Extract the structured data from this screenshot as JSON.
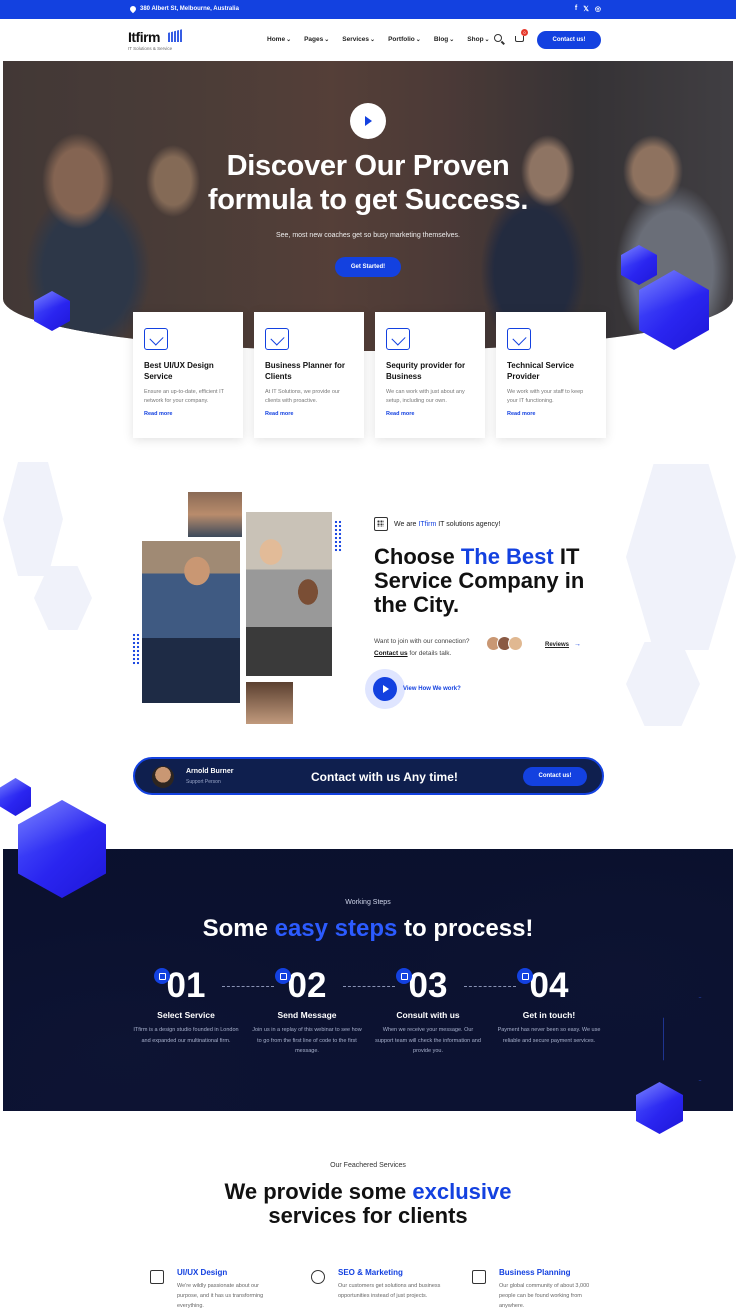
{
  "topbar": {
    "address": "380 Albert St, Melbourne, Australia",
    "social": [
      "f",
      "𝕏",
      "◎"
    ]
  },
  "header": {
    "logo_name": "Itfirm",
    "logo_tagline": "IT Solutions & Service",
    "nav": [
      "Home",
      "Pages",
      "Services",
      "Portfolio",
      "Blog",
      "Shop"
    ],
    "cart_count": "0",
    "cta": "Contact us!"
  },
  "hero": {
    "title_line1": "Discover Our Proven",
    "title_line2": "formula to get Success.",
    "subtitle": "See, most new coaches get so busy marketing themselves.",
    "button": "Get Started!"
  },
  "cards": [
    {
      "title": "Best UI/UX Design Service",
      "text": "Ensure an up-to-date, efficient IT network for your company.",
      "link": "Read more"
    },
    {
      "title": "Business Planner for Clients",
      "text": "At IT Solutions, we provide our clients with proactive.",
      "link": "Read more"
    },
    {
      "title": "Sequrity provider for Business",
      "text": "We can work with just about any setup, including our own.",
      "link": "Read more"
    },
    {
      "title": "Technical Service Provider",
      "text": "We work with your staff to keep your IT functioning.",
      "link": "Read more"
    }
  ],
  "about": {
    "kicker_prefix": "We are",
    "kicker_brand": "ITfirm",
    "kicker_suffix": "IT solutions agency!",
    "title_prefix": "Choose",
    "title_highlight": "The Best",
    "title_suffix": "IT Service Company in the City.",
    "question_line": "Want to join with our connection?",
    "contact_link": "Contact us",
    "contact_suffix": "for details talk.",
    "reviews": "Reviews",
    "video_link": "View How We work?"
  },
  "contact_bar": {
    "name": "Arnold Burner",
    "role": "Support Person",
    "text": "Contact with us Any time!",
    "button": "Contact us!"
  },
  "steps": {
    "kicker": "Working Steps",
    "title_prefix": "Some",
    "title_highlight": "easy steps",
    "title_suffix": "to process!",
    "items": [
      {
        "num": "01",
        "title": "Select Service",
        "text": "ITfirm is a design studio founded in London and expanded our multinational firm."
      },
      {
        "num": "02",
        "title": "Send Message",
        "text": "Join us in a replay of this webinar to see how to go from the first line of code to the first message."
      },
      {
        "num": "03",
        "title": "Consult with us",
        "text": "When we receive your message. Our support team will check the information and provide you."
      },
      {
        "num": "04",
        "title": "Get in touch!",
        "text": "Payment has never been so easy. We use reliable and secure payment services."
      }
    ]
  },
  "services": {
    "kicker": "Our Feachered Services",
    "title_prefix": "We provide some",
    "title_highlight": "exclusive",
    "title_line2": "services for clients",
    "items": [
      {
        "title": "UI/UX Design",
        "text": "We're wildly passionate about our purpose, and it has us transforming everything."
      },
      {
        "title": "SEO & Marketing",
        "text": "Our customers get solutions and business opportunities instead of just projects."
      },
      {
        "title": "Business Planning",
        "text": "Our global community of about 3,000 people can be found working from anywhere."
      }
    ]
  }
}
